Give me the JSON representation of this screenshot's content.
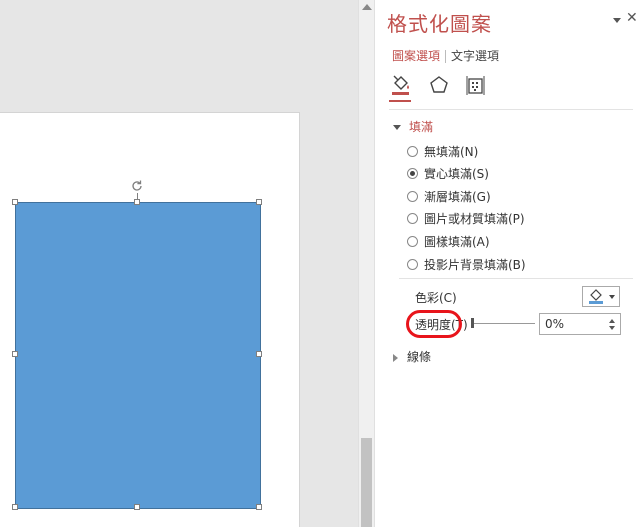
{
  "pane": {
    "title": "格式化圖案",
    "menu_icon": "chevron-down-icon",
    "close_icon": "close-icon",
    "close_glyph": "✕",
    "tabs": [
      {
        "label": "圖案選項",
        "active": true
      },
      {
        "label": "文字選項",
        "active": false
      }
    ],
    "icons": [
      "fill-bucket-icon",
      "pentagon-effects-icon",
      "size-properties-icon"
    ],
    "fill_section": {
      "header": "填滿",
      "options": [
        {
          "label": "無填滿(N)",
          "checked": false
        },
        {
          "label": "實心填滿(S)",
          "checked": true
        },
        {
          "label": "漸層填滿(G)",
          "checked": false
        },
        {
          "label": "圖片或材質填滿(P)",
          "checked": false
        },
        {
          "label": "圖樣填滿(A)",
          "checked": false
        },
        {
          "label": "投影片背景填滿(B)",
          "checked": false
        }
      ],
      "color_label": "色彩(C)",
      "color_value": "#5b9bd5",
      "transparency_label": "透明度(T)",
      "transparency_value": "0%"
    },
    "line_section": {
      "header": "線條"
    }
  },
  "colors": {
    "accent": "#c0504d",
    "shape_fill": "#5b9bd5",
    "highlight": "#e8141b"
  }
}
